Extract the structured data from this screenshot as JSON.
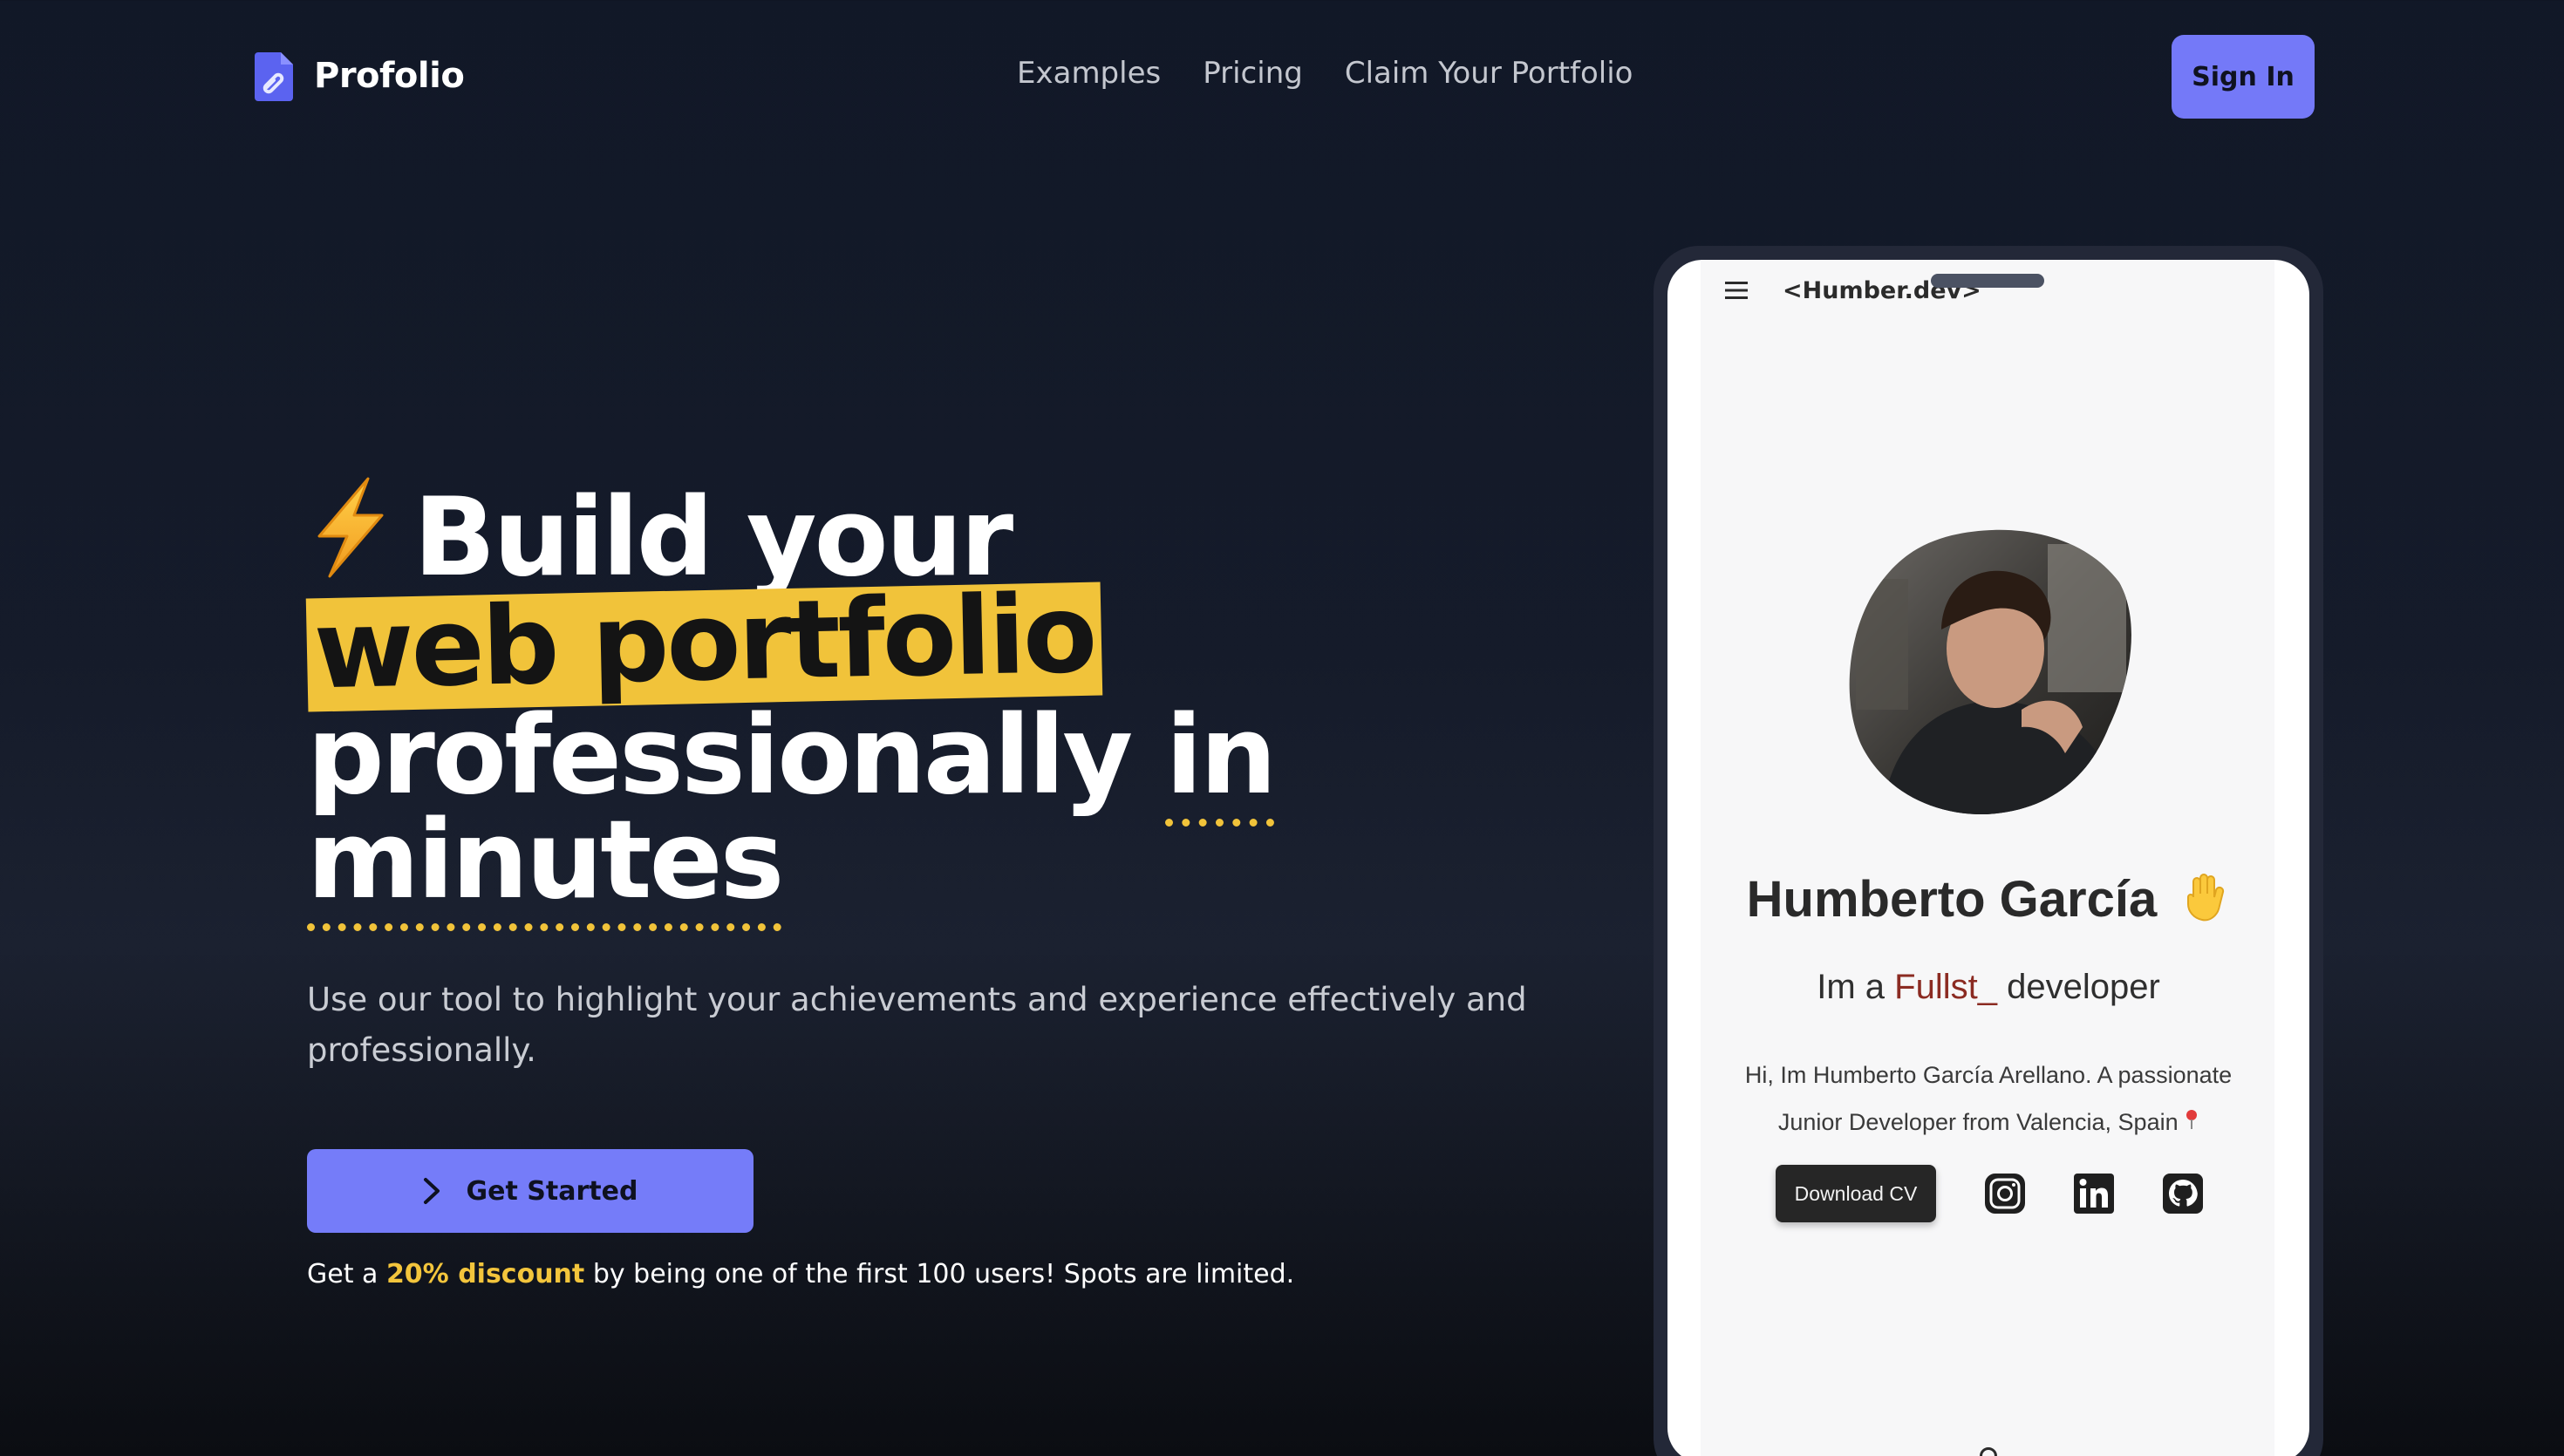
{
  "header": {
    "logo_text": "Profolio",
    "nav": [
      {
        "label": "Examples"
      },
      {
        "label": "Pricing"
      },
      {
        "label": "Claim Your Portfolio"
      }
    ],
    "signin_label": "Sign In"
  },
  "hero": {
    "title_line1": "Build your",
    "title_highlight": "web portfolio",
    "title_line3_a": "professionally",
    "title_line3_b": "in",
    "title_line4": "minutes",
    "subtitle": "Use our tool to highlight your achievements and experience effectively and professionally.",
    "cta_label": "Get Started",
    "discount_prefix": "Get a",
    "discount_value": "20% discount",
    "discount_suffix": "by being one of the first 100 users! Spots are limited."
  },
  "phone": {
    "site_brand": "<Humber.dev>",
    "profile_name": "Humberto García",
    "role_prefix": "Im a",
    "role_typed": "Fullst_",
    "role_suffix": "developer",
    "bio": "Hi, Im Humberto García Arellano. A passionate Junior Developer from Valencia, Spain",
    "download_label": "Download CV",
    "social_icons": [
      "instagram-icon",
      "linkedin-icon",
      "github-icon"
    ]
  },
  "colors": {
    "accent": "#757cf9",
    "highlight": "#f1c33a",
    "background": "#111827",
    "role_typed": "#8b2b22"
  }
}
